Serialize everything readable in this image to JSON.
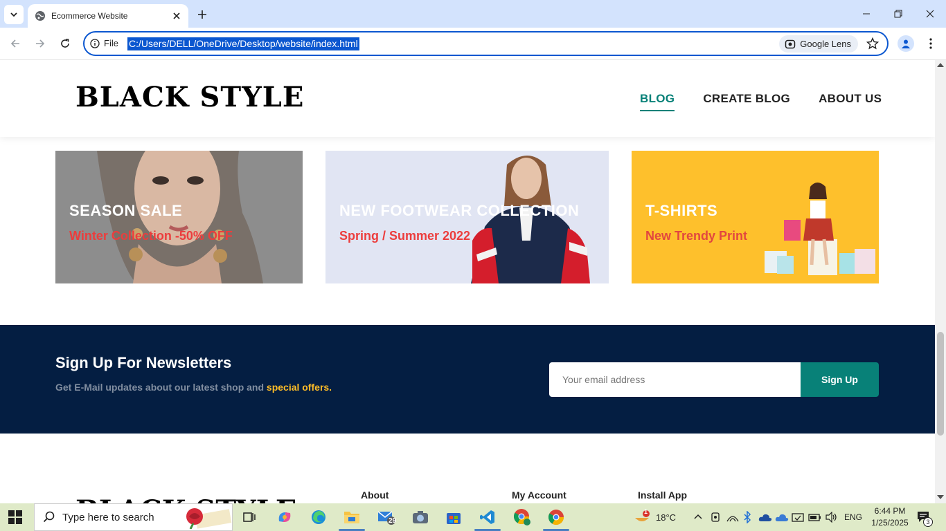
{
  "browser": {
    "tab_title": "Ecommerce Website",
    "omnibox_scheme": "File",
    "url": "C:/Users/DELL/OneDrive/Desktop/website/index.html",
    "lens_label": "Google Lens"
  },
  "site": {
    "logo": "BLACK STYLE",
    "nav": [
      {
        "label": "BLOG",
        "active": true
      },
      {
        "label": "CREATE BLOG",
        "active": false
      },
      {
        "label": "ABOUT US",
        "active": false
      }
    ]
  },
  "banners": [
    {
      "title": "SEASON SALE",
      "subtitle": "Winter Collection -50% OFF"
    },
    {
      "title": "NEW FOOTWEAR COLLECTION",
      "subtitle": "Spring / Summer 2022"
    },
    {
      "title": "T-SHIRTS",
      "subtitle": "New Trendy Print"
    }
  ],
  "newsletter": {
    "title": "Sign Up For Newsletters",
    "text": "Get E-Mail updates about our latest shop and",
    "highlight": "special offers.",
    "placeholder": "Your email address",
    "button": "Sign Up"
  },
  "footer": {
    "logo": "BLACK STYLE",
    "columns": [
      "About",
      "My Account",
      "Install App"
    ]
  },
  "taskbar": {
    "search_placeholder": "Type here to search",
    "mail_badge": "29",
    "weather": "18°C",
    "weather_badge": "1",
    "language": "ENG",
    "time": "6:44 PM",
    "date": "1/25/2025",
    "notification_count": "3"
  },
  "colors": {
    "accent": "#088178",
    "newsletter_bg": "#041e42",
    "highlight": "#ffbd27",
    "banner_red": "#ec3d3d",
    "browser_blue": "#0b57d0"
  }
}
